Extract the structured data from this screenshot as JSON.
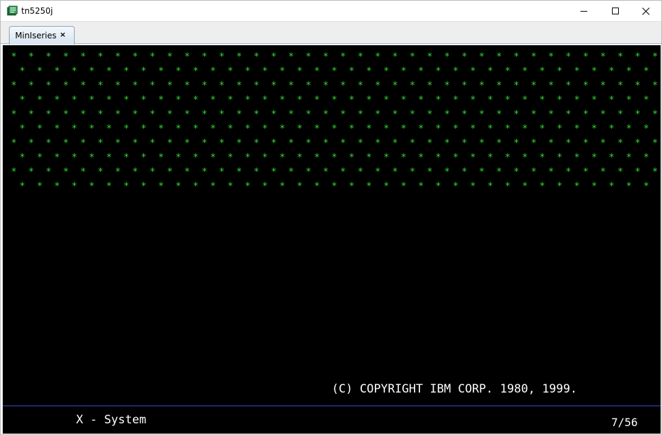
{
  "window": {
    "title": "tn5250j",
    "icon": "tn5250j-app-icon",
    "controls": [
      "minimize-icon",
      "maximize-icon",
      "close-icon"
    ]
  },
  "tabs": [
    {
      "label": "MinIseries",
      "close": "×",
      "active": true
    }
  ],
  "terminal": {
    "star_rows": [
      "*  *  *  *  *  *  *  *  *  *  *  *  *  *  *  *  *  *  *  *  *  *  *  *  *  *  *  *  *  *  *  *  *  *  *  *  *  *  *",
      " *  *  *  *  *  *  *  *  *  *  *  *  *  *  *  *  *  *  *  *  *  *  *  *  *  *  *  *  *  *  *  *  *  *  *  *  *  *  *",
      "*  *  *  *  *  *  *  *  *  *  *  *  *  *  *  *  *  *  *  *  *  *  *  *  *  *  *  *  *  *  *  *  *  *  *  *  *  *  *",
      " *  *  *  *  *  *  *  *  *  *  *  *  *  *  *  *  *  *  *  *  *  *  *  *  *  *  *  *  *  *  *  *  *  *  *  *  *  *  *",
      "*  *  *  *  *  *  *  *  *  *  *  *  *  *  *  *  *  *  *  *  *  *  *  *  *  *  *  *  *  *  *  *  *  *  *  *  *  *  *",
      " *  *  *  *  *  *  *  *  *  *  *  *  *  *  *  *  *  *  *  *  *  *  *  *  *  *  *  *  *  *  *  *  *  *  *  *  *  *  *",
      "*  *  *  *  *  *  *  *  *  *  *  *  *  *  *  *  *  *  *  *  *  *  *  *  *  *  *  *  *  *  *  *  *  *  *  *  *  *  *",
      " *  *  *  *  *  *  *  *  *  *  *  *  *  *  *  *  *  *  *  *  *  *  *  *  *  *  *  *  *  *  *  *  *  *  *  *  *  *  *",
      "*  *  *  *  *  *  *  *  *  *  *  *  *  *  *  *  *  *  *  *  *  *  *  *  *  *  *  *  *  *  *  *  *  *  *  *  *  *  *",
      " *  *  *  *  *  *  *  *  *  *  *  *  *  *  *  *  *  *  *  *  *  *  *  *  *  *  *  *  *  *  *  *  *  *  *  *  *  *  *"
    ],
    "copyright": "(C) COPYRIGHT IBM CORP. 1980, 1999.",
    "status_left": "X - System",
    "status_right": "7/56",
    "colors": {
      "background": "#000000",
      "stars": "#33d633",
      "text": "#ffffff",
      "oia_separator": "#3a4ccc"
    }
  }
}
